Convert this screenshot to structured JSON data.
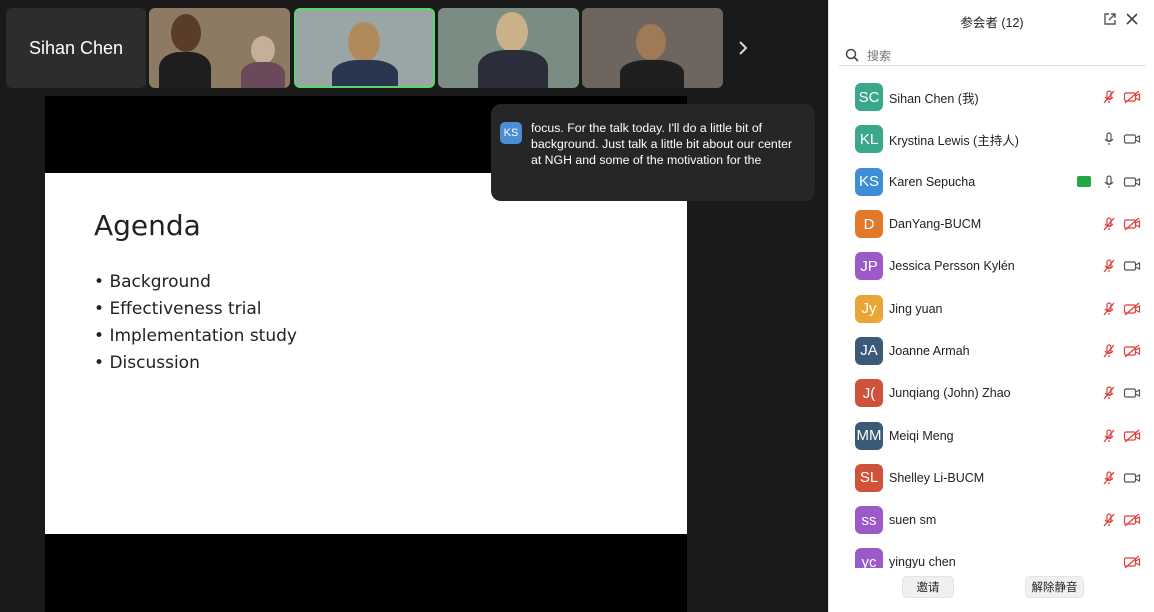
{
  "meeting": {
    "self_tile_name": "Sihan Chen",
    "caption": {
      "speaker_initials": "KS",
      "text": "focus. For the talk today. I'll do a little bit of background. Just talk a little bit about our center at NGH and some of the motivation for the"
    },
    "slide": {
      "title": "Agenda",
      "bullets": [
        "Background",
        "Effectiveness trial",
        "Implementation study",
        "Discussion"
      ]
    }
  },
  "panel": {
    "title": "参会者 (12)",
    "search_placeholder": "搜索",
    "participants": [
      {
        "initials": "SC",
        "name": "Sihan Chen (我)",
        "color": "#3aa88a",
        "mic": "muted",
        "cam": "off"
      },
      {
        "initials": "KL",
        "name": "Krystina Lewis (主持人)",
        "color": "#3aa88a",
        "mic": "on",
        "cam": "on"
      },
      {
        "initials": "KS",
        "name": "Karen Sepucha",
        "color": "#3d8ed6",
        "mic": "on",
        "cam": "on",
        "sharing": true
      },
      {
        "initials": "D",
        "name": "DanYang-BUCM",
        "color": "#e07a2a",
        "mic": "muted",
        "cam": "off"
      },
      {
        "initials": "JP",
        "name": "Jessica Persson Kylén",
        "color": "#9b59c9",
        "mic": "muted",
        "cam": "on"
      },
      {
        "initials": "Jy",
        "name": "Jing yuan",
        "color": "#e8a735",
        "mic": "muted",
        "cam": "off"
      },
      {
        "initials": "JA",
        "name": "Joanne Armah",
        "color": "#3b5a78",
        "mic": "muted",
        "cam": "off"
      },
      {
        "initials": "J(",
        "name": "Junqiang (John) Zhao",
        "color": "#d1523b",
        "mic": "muted",
        "cam": "on"
      },
      {
        "initials": "MM",
        "name": "Meiqi Meng",
        "color": "#3b5a78",
        "mic": "muted",
        "cam": "off"
      },
      {
        "initials": "SL",
        "name": "Shelley Li-BUCM",
        "color": "#d1523b",
        "mic": "muted",
        "cam": "on"
      },
      {
        "initials": "ss",
        "name": "suen sm",
        "color": "#9b59c9",
        "mic": "muted",
        "cam": "off"
      },
      {
        "initials": "yc",
        "name": "yingyu chen",
        "color": "#9b59c9",
        "mic": "none",
        "cam": "off"
      }
    ],
    "footer": {
      "invite_label": "邀请",
      "unmute_label": "解除静音"
    }
  }
}
